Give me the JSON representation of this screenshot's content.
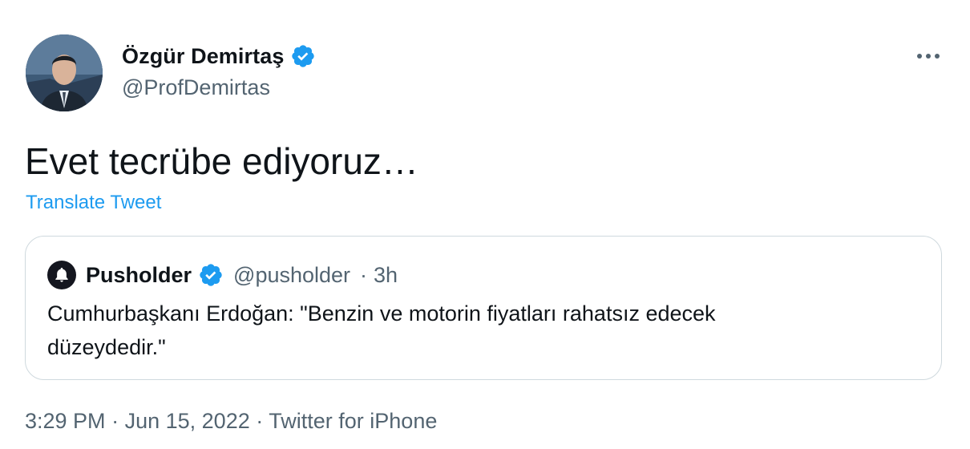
{
  "author": {
    "name": "Özgür Demirtaş",
    "handle": "@ProfDemirtas",
    "verified": true,
    "avatar_icon": "profile-photo-icon"
  },
  "more_icon": "more-options-icon",
  "tweet": {
    "text": "Evet tecrübe ediyoruz…",
    "translate_label": "Translate Tweet"
  },
  "quoted_tweet": {
    "name": "Pusholder",
    "handle": "@pusholder",
    "separator": "·",
    "age": "3h",
    "verified": true,
    "avatar_icon": "bell-icon",
    "text_line1": "Cumhurbaşkanı Erdoğan: \"Benzin ve motorin fiyatları rahatsız edecek",
    "text_line2": "düzeydedir.\""
  },
  "footer": {
    "time": "3:29 PM",
    "date": "Jun 15, 2022",
    "source": "Twitter for iPhone",
    "separator": "·"
  },
  "colors": {
    "accent": "#1d9bf0",
    "secondary_text": "#536471",
    "primary_text": "#0f1419",
    "border": "#cfd9de"
  }
}
